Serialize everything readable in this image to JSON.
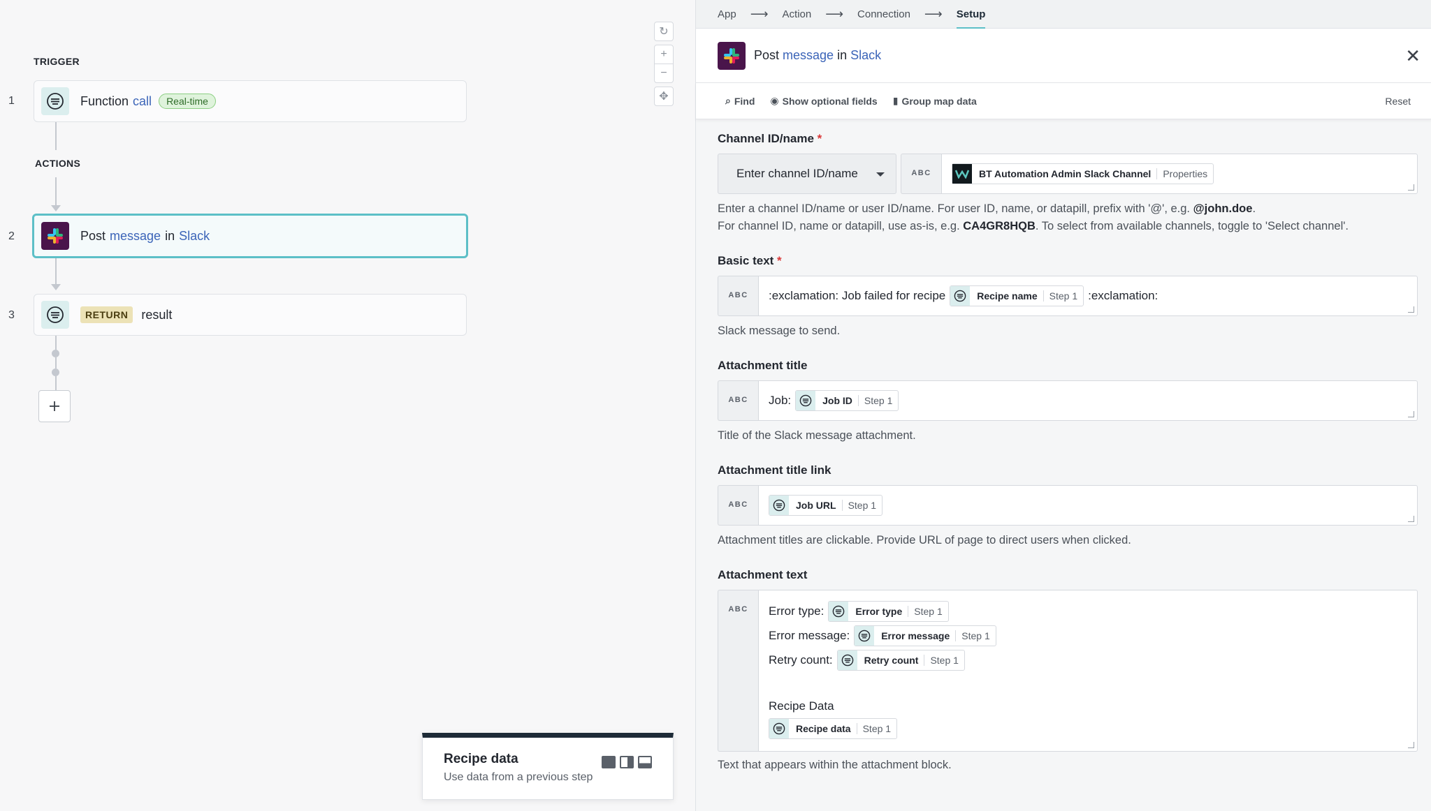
{
  "canvas": {
    "trigger_label": "TRIGGER",
    "actions_label": "ACTIONS",
    "steps": [
      {
        "num": "1",
        "prefix": "Function",
        "link": "call",
        "badge": "Real-time"
      },
      {
        "num": "2",
        "prefix": "Post",
        "link": "message",
        "mid": "in",
        "link2": "Slack"
      },
      {
        "num": "3",
        "badge": "RETURN",
        "text": "result"
      }
    ],
    "recipe_panel": {
      "title": "Recipe data",
      "subtitle": "Use data from a previous step"
    }
  },
  "panel": {
    "breadcrumbs": [
      "App",
      "Action",
      "Connection",
      "Setup"
    ],
    "header": {
      "prefix": "Post",
      "link": "message",
      "mid": "in",
      "link2": "Slack"
    },
    "toolbar": {
      "find": "Find",
      "optional": "Show optional fields",
      "group": "Group map data",
      "reset": "Reset"
    },
    "abc": "ABC",
    "fields": {
      "channel": {
        "label": "Channel ID/name",
        "select": "Enter channel ID/name",
        "pill": {
          "name": "BT Automation Admin Slack Channel",
          "step": "Properties"
        },
        "help1_a": "Enter a channel ID/name or user ID/name. For user ID, name, or datapill, prefix with '@', e.g. ",
        "help1_b": "@john.doe",
        "help1_c": ".",
        "help2_a": "For channel ID, name or datapill, use as-is, e.g. ",
        "help2_b": "CA4GR8HQB",
        "help2_c": ". To select from available channels, toggle to 'Select channel'."
      },
      "basic": {
        "label": "Basic text",
        "before": ":exclamation: Job failed for recipe",
        "pill": {
          "name": "Recipe name",
          "step": "Step 1"
        },
        "after": ":exclamation:",
        "help": "Slack message to send."
      },
      "title": {
        "label": "Attachment title",
        "before": "Job:",
        "pill": {
          "name": "Job ID",
          "step": "Step 1"
        },
        "help": "Title of the Slack message attachment."
      },
      "title_link": {
        "label": "Attachment title link",
        "pill": {
          "name": "Job URL",
          "step": "Step 1"
        },
        "help": "Attachment titles are clickable. Provide URL of page to direct users when clicked."
      },
      "text": {
        "label": "Attachment text",
        "lines": [
          {
            "label": "Error type:",
            "pill": "Error type",
            "step": "Step 1"
          },
          {
            "label": "Error message:",
            "pill": "Error message",
            "step": "Step 1"
          },
          {
            "label": "Retry count:",
            "pill": "Retry count",
            "step": "Step 1"
          }
        ],
        "recipe_label": "Recipe Data",
        "recipe_pill": {
          "name": "Recipe data",
          "step": "Step 1"
        },
        "help": "Text that appears within the attachment block."
      }
    }
  },
  "colors": {
    "accent": "#5cbfc7",
    "link": "#3b64b8",
    "slack_bg": "#4a154b",
    "required": "#d93737"
  }
}
